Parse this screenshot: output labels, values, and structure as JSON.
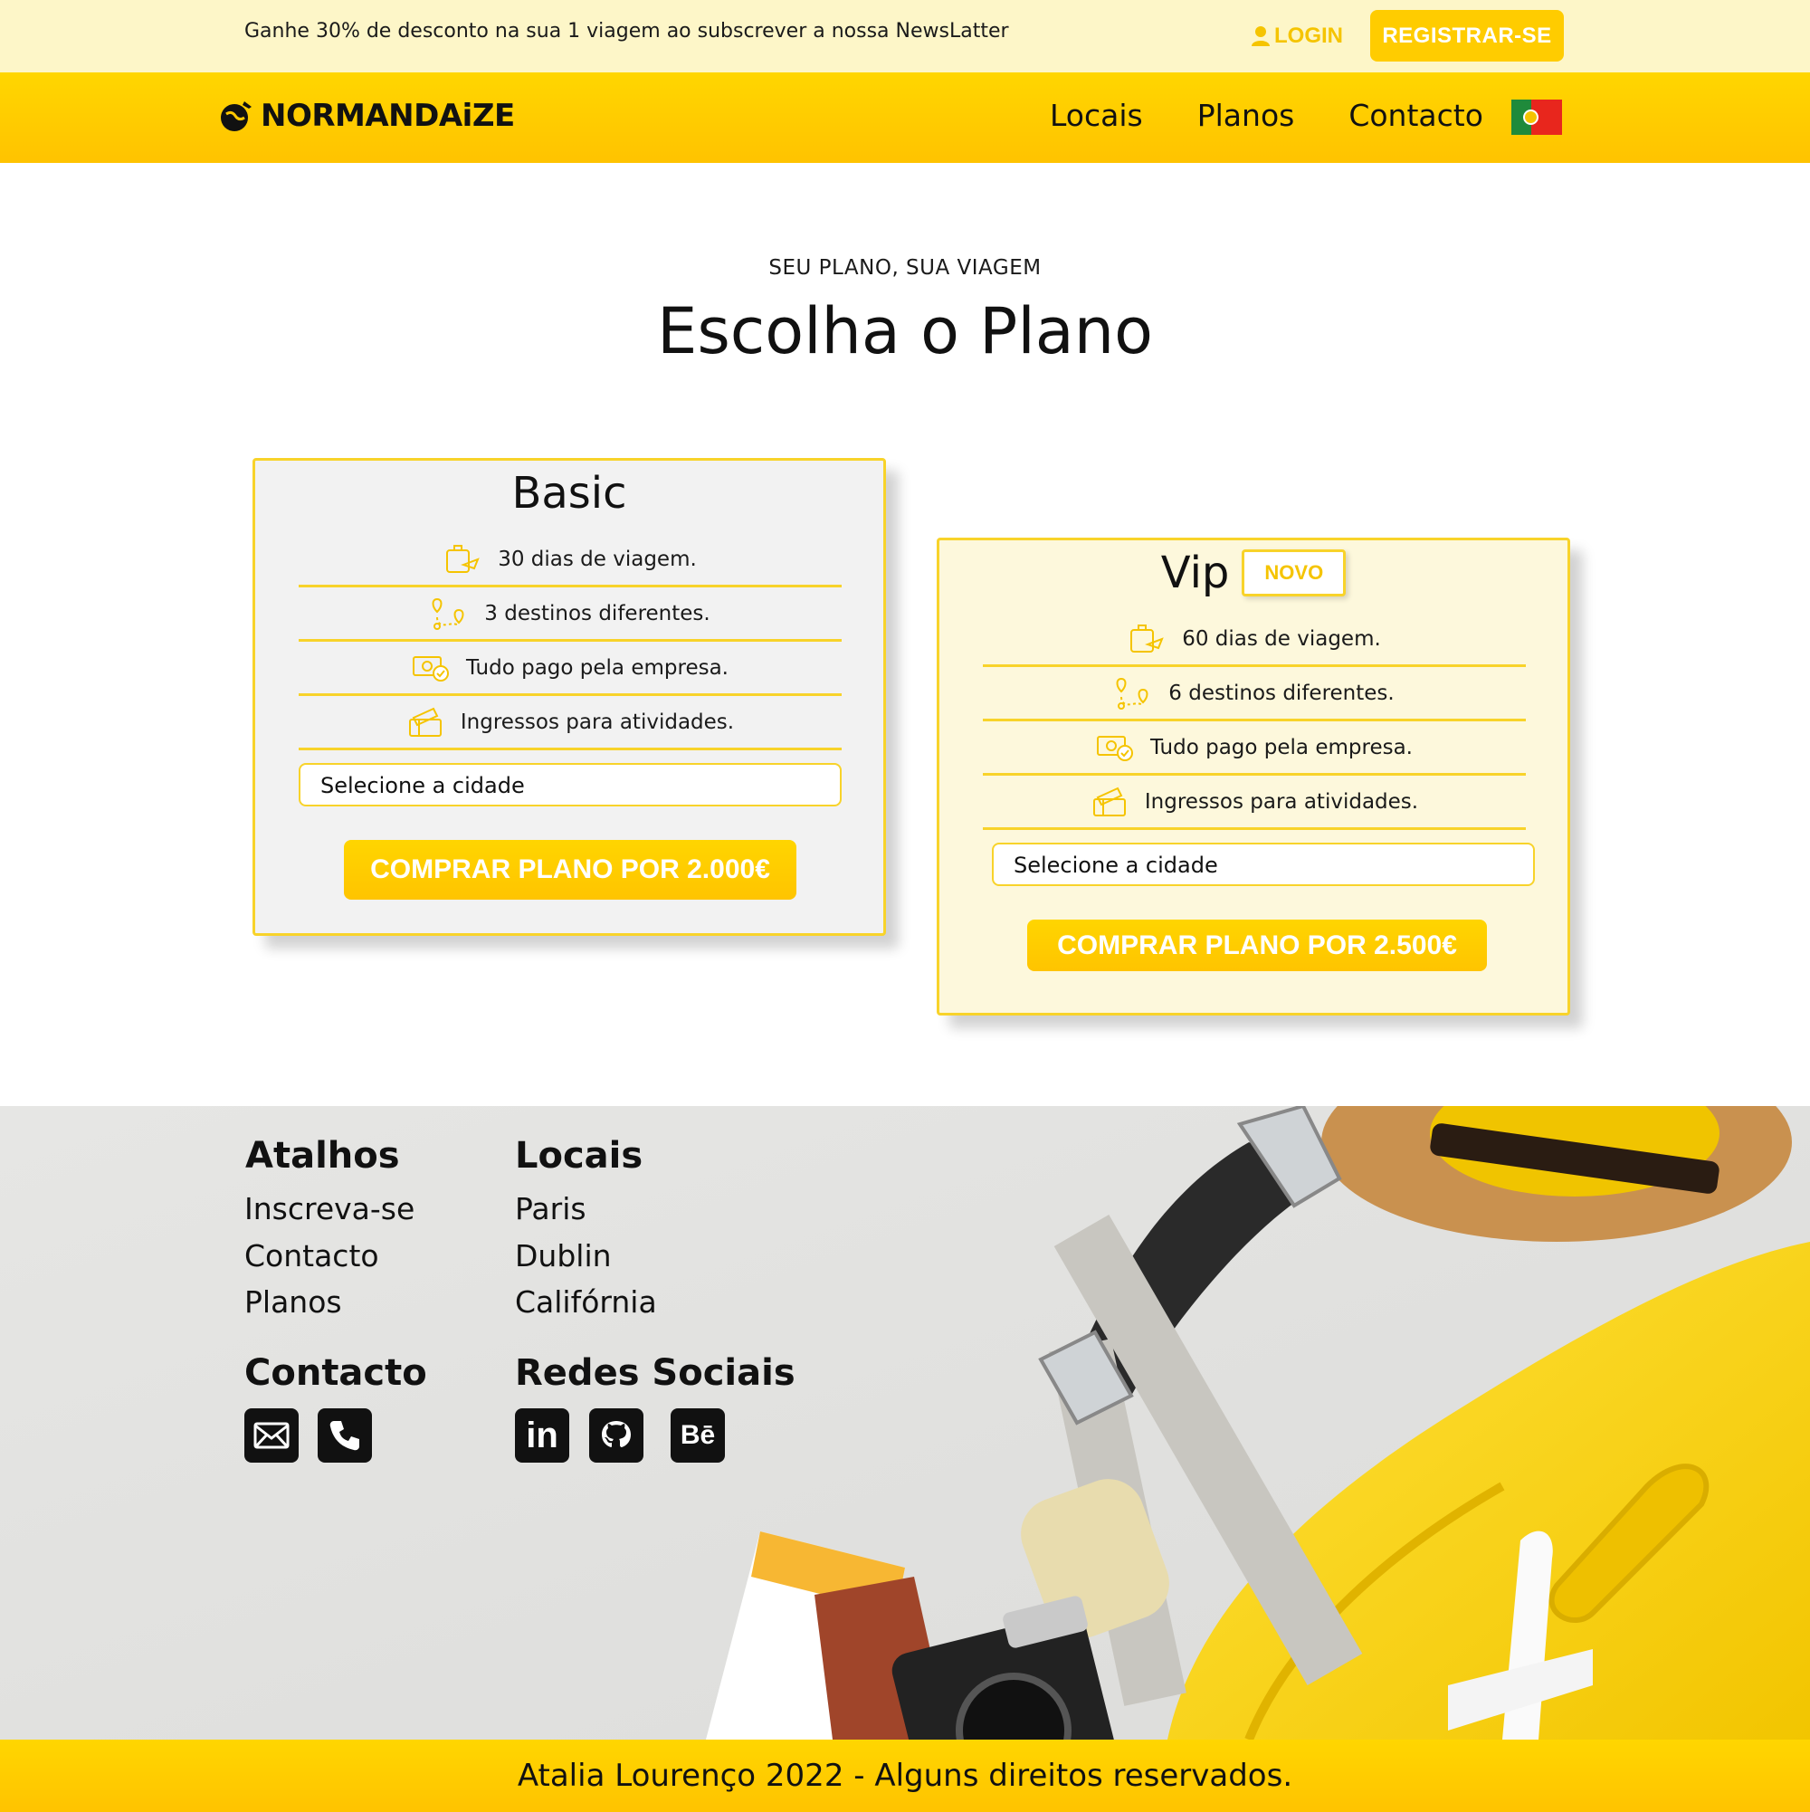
{
  "promo": {
    "text": "Ganhe 30% de desconto na sua 1 viagem ao subscrever a nossa NewsLatter",
    "login_label": "LOGIN",
    "register_label": "REGISTRAR-SE"
  },
  "nav": {
    "logo_text": "NORMANDAiZE",
    "links": [
      "Locais",
      "Planos",
      "Contacto"
    ],
    "language_flag": "portugal-flag-icon"
  },
  "header": {
    "kicker": "SEU PLANO, SUA VIAGEM",
    "title": "Escolha o Plano"
  },
  "plans": [
    {
      "name": "Basic",
      "features": [
        {
          "icon": "luggage-plane-icon",
          "text": "30 dias de viagem."
        },
        {
          "icon": "map-pin-route-icon",
          "text": "3 destinos diferentes."
        },
        {
          "icon": "money-check-icon",
          "text": "Tudo pago pela empresa."
        },
        {
          "icon": "tickets-icon",
          "text": "Ingressos para atividades."
        }
      ],
      "select_placeholder": "Selecione a cidade",
      "button_label": "COMPRAR PLANO POR 2.000€"
    },
    {
      "name": "Vip",
      "badge": "NOVO",
      "features": [
        {
          "icon": "luggage-plane-icon",
          "text": "60 dias de viagem."
        },
        {
          "icon": "map-pin-route-icon",
          "text": "6 destinos diferentes."
        },
        {
          "icon": "money-check-icon",
          "text": "Tudo pago pela empresa."
        },
        {
          "icon": "tickets-icon",
          "text": "Ingressos para atividades."
        }
      ],
      "select_placeholder": "Selecione a cidade",
      "button_label": "COMPRAR PLANO POR 2.500€"
    }
  ],
  "footer": {
    "shortcuts": {
      "title": "Atalhos",
      "links": [
        "Inscreva-se",
        "Contacto",
        "Planos"
      ]
    },
    "places": {
      "title": "Locais",
      "links": [
        "Paris",
        "Dublin",
        "Califórnia"
      ]
    },
    "contact": {
      "title": "Contacto",
      "icons": [
        "mail-icon",
        "phone-icon"
      ]
    },
    "social": {
      "title": "Redes Sociais",
      "icons": [
        "linkedin-icon",
        "github-icon",
        "behance-icon"
      ],
      "linkedin_text": "in",
      "behance_text": "Bē"
    },
    "copyright": "Atalia Lourenço 2022 - Alguns direitos reservados."
  },
  "colors": {
    "accent": "#ffcc00",
    "promo_bg": "#fdf6c8",
    "card_border": "#f8d32a",
    "vip_bg": "#fdf8dc",
    "basic_bg": "#f2f2f2"
  }
}
